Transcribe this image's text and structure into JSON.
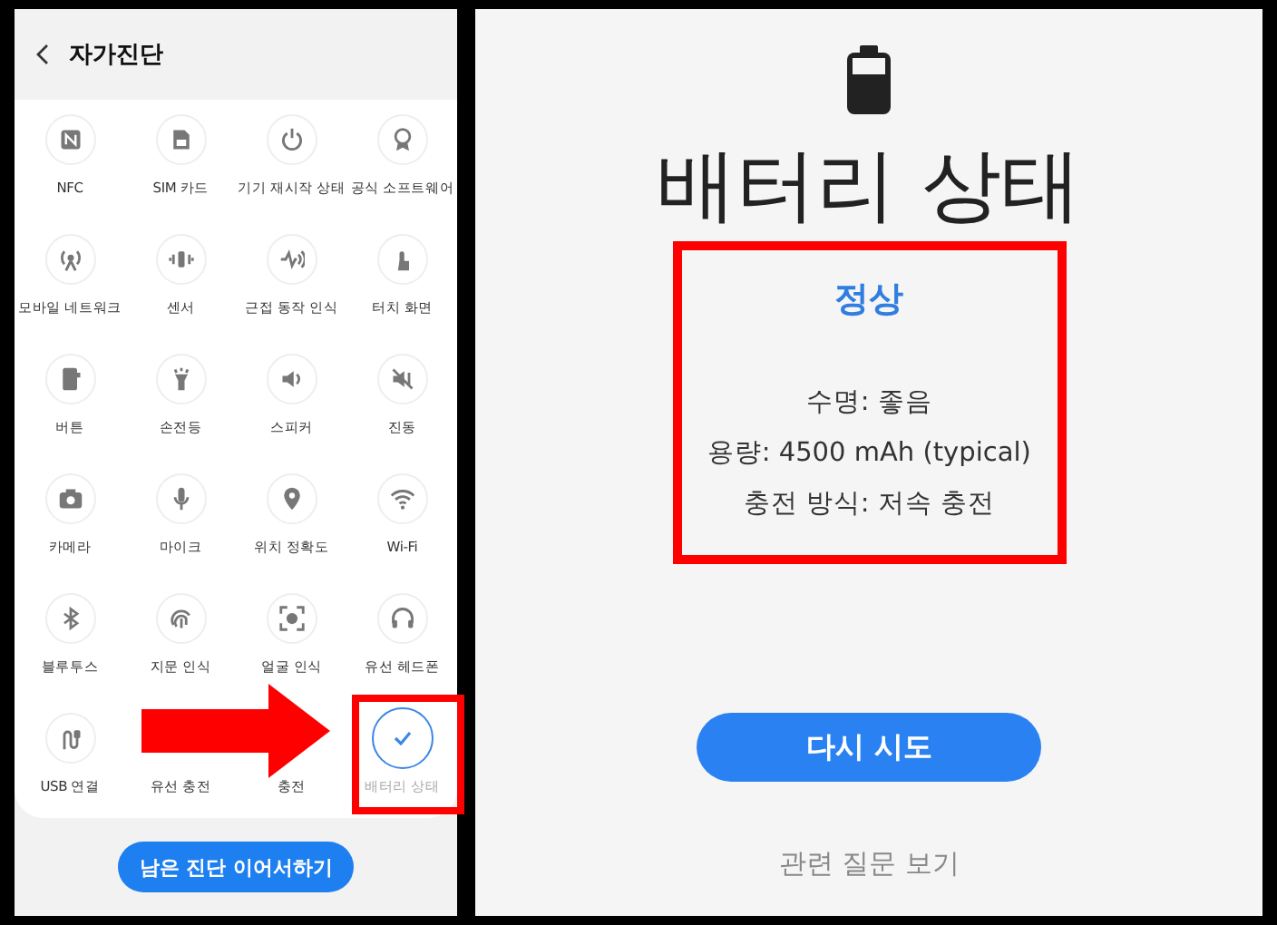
{
  "diagnostics": {
    "title": "자가진단",
    "tests": [
      {
        "label": "NFC",
        "checked": false,
        "highlighted": false
      },
      {
        "label": "SIM 카드",
        "checked": false,
        "highlighted": false
      },
      {
        "label": "기기 재시작 상태",
        "checked": false,
        "highlighted": false
      },
      {
        "label": "공식 소프트웨어",
        "checked": false,
        "highlighted": false
      },
      {
        "label": "모바일 네트워크",
        "checked": false,
        "highlighted": false
      },
      {
        "label": "센서",
        "checked": false,
        "highlighted": false
      },
      {
        "label": "근접 동작 인식",
        "checked": false,
        "highlighted": false
      },
      {
        "label": "터치 화면",
        "checked": false,
        "highlighted": false
      },
      {
        "label": "버튼",
        "checked": false,
        "highlighted": false
      },
      {
        "label": "손전등",
        "checked": false,
        "highlighted": false
      },
      {
        "label": "스피커",
        "checked": false,
        "highlighted": false
      },
      {
        "label": "진동",
        "checked": false,
        "highlighted": false
      },
      {
        "label": "카메라",
        "checked": false,
        "highlighted": false
      },
      {
        "label": "마이크",
        "checked": false,
        "highlighted": false
      },
      {
        "label": "위치 정확도",
        "checked": false,
        "highlighted": false
      },
      {
        "label": "Wi-Fi",
        "checked": false,
        "highlighted": false
      },
      {
        "label": "블루투스",
        "checked": false,
        "highlighted": false
      },
      {
        "label": "지문 인식",
        "checked": false,
        "highlighted": false
      },
      {
        "label": "얼굴 인식",
        "checked": false,
        "highlighted": false
      },
      {
        "label": "유선 헤드폰",
        "checked": false,
        "highlighted": false
      },
      {
        "label": "USB 연결",
        "checked": false,
        "highlighted": false
      },
      {
        "label": "유선 충전",
        "checked": false,
        "highlighted": false
      },
      {
        "label": "충전",
        "checked": false,
        "highlighted": false
      },
      {
        "label": "배터리 상태",
        "checked": true,
        "highlighted": true
      }
    ],
    "continue_button": "남은 진단 이어서하기",
    "arrow": true
  },
  "battery_result": {
    "title": "배터리 상태",
    "highlighted": true,
    "status": "정상",
    "details": [
      "수명: 좋음",
      "용량: 4500 mAh (typical)",
      "충전 방식: 저속 충전"
    ],
    "retry_button": "다시 시도",
    "related_link": "관련 질문 보기"
  }
}
